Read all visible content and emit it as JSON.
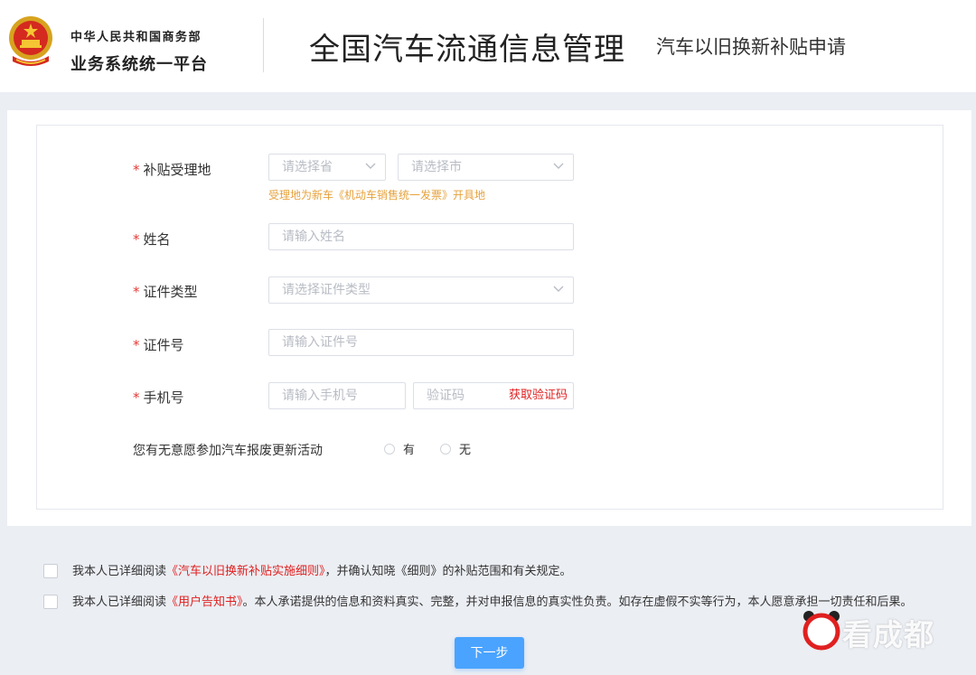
{
  "header": {
    "ministry_line1": "中华人民共和国商务部",
    "ministry_line2": "业务系统统一平台",
    "title": "全国汽车流通信息管理",
    "subtitle": "汽车以旧换新补贴申请"
  },
  "form": {
    "location": {
      "label": "补贴受理地",
      "province_placeholder": "请选择省",
      "city_placeholder": "请选择市",
      "hint": "受理地为新车《机动车销售统一发票》开具地"
    },
    "name": {
      "label": "姓名",
      "placeholder": "请输入姓名"
    },
    "id_type": {
      "label": "证件类型",
      "placeholder": "请选择证件类型"
    },
    "id_number": {
      "label": "证件号",
      "placeholder": "请输入证件号"
    },
    "phone": {
      "label": "手机号",
      "placeholder": "请输入手机号",
      "code_placeholder": "验证码",
      "code_button": "获取验证码"
    },
    "scrap_intent": {
      "label": "您有无意愿参加汽车报废更新活动",
      "options": [
        "有",
        "无"
      ]
    }
  },
  "agreements": {
    "a1_prefix": "我本人已详细阅读",
    "a1_link": "《汽车以旧换新补贴实施细则》",
    "a1_suffix": "，并确认知晓《细则》的补贴范围和有关规定。",
    "a2_prefix": "我本人已详细阅读",
    "a2_link": "《用户告知书》",
    "a2_suffix": "。本人承诺提供的信息和资料真实、完整，并对申报信息的真实性负责。如存在虚假不实等行为，本人愿意承担一切责任和后果。"
  },
  "next_button": "下一步",
  "watermark": "看成都",
  "colors": {
    "required": "#e53935",
    "link": "#e02020",
    "hint": "#e6a23c",
    "primary_button": "#4aa3ff",
    "page_bg": "#ebeef3"
  }
}
